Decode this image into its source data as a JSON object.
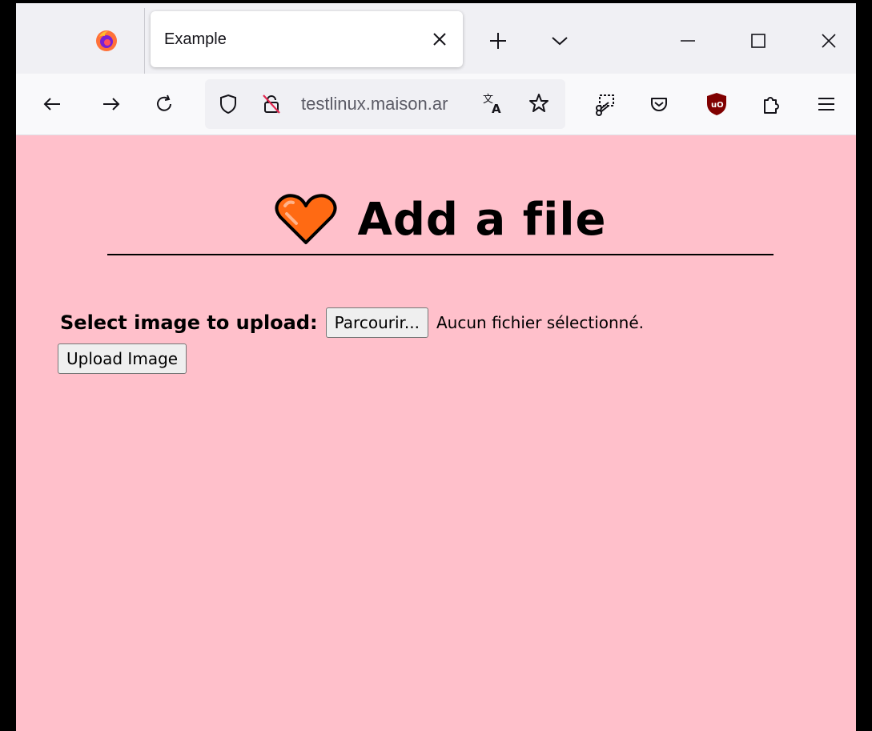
{
  "browser": {
    "tab_title": "Example",
    "url": "testlinux.maison.ar",
    "icons": {
      "logo": "firefox-logo",
      "tab_close": "close-icon",
      "new_tab": "plus-icon",
      "tab_list": "chevron-down-icon",
      "minimize": "minimize-icon",
      "maximize": "maximize-icon",
      "close_window": "close-icon",
      "back": "back-arrow-icon",
      "forward": "forward-arrow-icon",
      "reload": "reload-icon",
      "tracking": "shield-icon",
      "insecure": "insecure-lock-icon",
      "translate": "translate-icon",
      "bookmark": "star-icon",
      "screenshot": "screenshot-icon",
      "pocket": "pocket-icon",
      "ublock": "ublock-icon",
      "extensions": "extensions-icon",
      "menu": "hamburger-menu-icon"
    }
  },
  "page": {
    "heading": "Add a file",
    "background": "#ffc0cb",
    "heart_color": "#ff6a13",
    "form": {
      "label": "Select image to upload:",
      "browse_button": "Parcourir...",
      "file_status": "Aucun fichier sélectionné.",
      "upload_button": "Upload Image"
    }
  }
}
